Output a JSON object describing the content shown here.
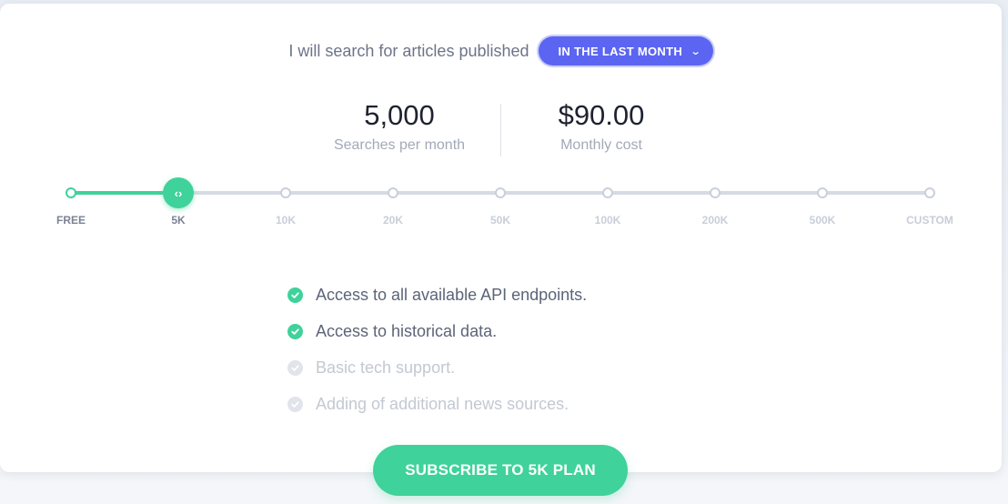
{
  "header": {
    "prefix": "I will search for articles published",
    "period_selected": "IN THE LAST MONTH",
    "period_icon": "chevron-down-icon"
  },
  "stats": {
    "searches_value": "5,000",
    "searches_label": "Searches per month",
    "cost_value": "$90.00",
    "cost_label": "Monthly cost"
  },
  "slider": {
    "handle_icon": "drag-arrows-icon",
    "handle_glyph": "‹›",
    "selected_index": 1,
    "stops": [
      "FREE",
      "5K",
      "10K",
      "20K",
      "50K",
      "100K",
      "200K",
      "500K",
      "CUSTOM"
    ]
  },
  "features": [
    {
      "label": "Access to all available API endpoints.",
      "included": true
    },
    {
      "label": "Access to historical data.",
      "included": true
    },
    {
      "label": "Basic tech support.",
      "included": false
    },
    {
      "label": "Adding of additional news sources.",
      "included": false
    }
  ],
  "cta": {
    "label": "SUBSCRIBE TO 5K PLAN"
  },
  "colors": {
    "accent_green": "#3fd29a",
    "dropdown_blue": "#5b65f2"
  }
}
